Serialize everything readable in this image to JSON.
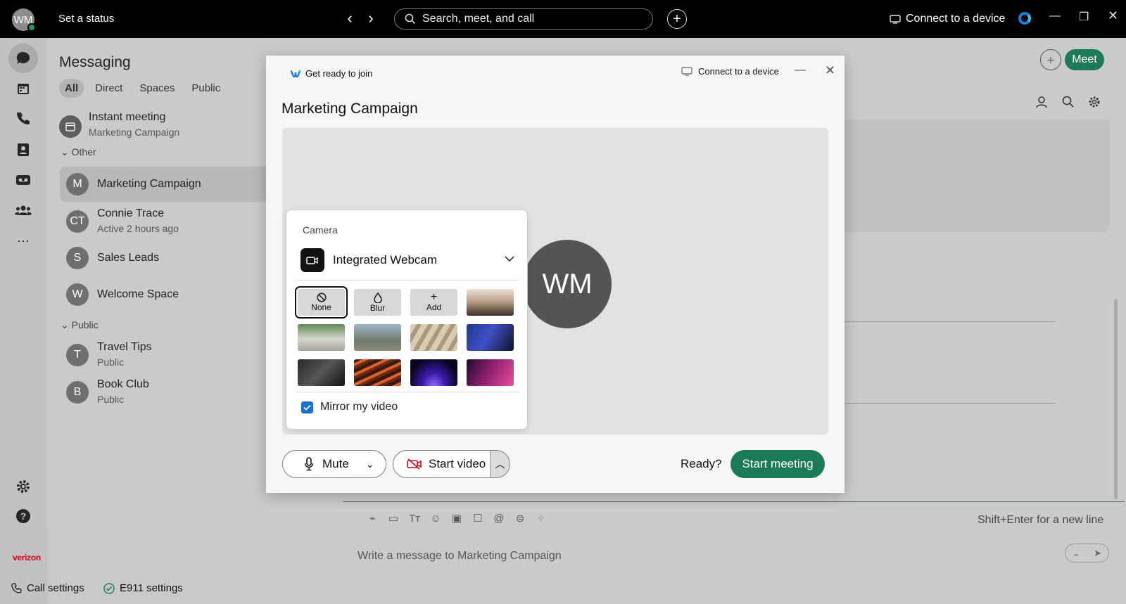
{
  "topbar": {
    "avatar_initials": "WM",
    "status_text": "Set a status",
    "search_placeholder": "Search, meet, and call",
    "connect_label": "Connect to a device"
  },
  "messaging": {
    "title": "Messaging",
    "filters": [
      "All",
      "Direct",
      "Spaces",
      "Public"
    ],
    "active_filter": "All",
    "instant_meeting": {
      "title": "Instant meeting",
      "subtitle": "Marketing Campaign"
    },
    "sections": {
      "other": "Other",
      "public": "Public"
    },
    "other_items": [
      {
        "initials": "M",
        "title": "Marketing Campaign",
        "subtitle": ""
      },
      {
        "initials": "CT",
        "title": "Connie Trace",
        "subtitle": "Active 2 hours ago"
      },
      {
        "initials": "S",
        "title": "Sales Leads",
        "subtitle": ""
      },
      {
        "initials": "W",
        "title": "Welcome Space",
        "subtitle": ""
      }
    ],
    "public_items": [
      {
        "initials": "T",
        "title": "Travel Tips",
        "subtitle": "Public"
      },
      {
        "initials": "B",
        "title": "Book Club",
        "subtitle": "Public"
      }
    ]
  },
  "space_header": {
    "meet_label": "Meet"
  },
  "composer": {
    "hint": "Shift+Enter for a new line",
    "placeholder": "Write a message to Marketing Campaign"
  },
  "brand": {
    "carrier": "verizon"
  },
  "bottombar": {
    "call_settings": "Call settings",
    "e911_settings": "E911 settings"
  },
  "dialog": {
    "title": "Get ready to join",
    "connect_label": "Connect to a device",
    "meeting_name": "Marketing Campaign",
    "avatar_initials": "WM",
    "camera": {
      "label": "Camera",
      "selected_camera": "Integrated Webcam",
      "options": {
        "none": "None",
        "blur": "Blur",
        "add": "Add"
      },
      "mirror_label": "Mirror my video",
      "mirror_checked": true
    },
    "mute_label": "Mute",
    "start_video_label": "Start video",
    "ready_label": "Ready?",
    "start_meeting_label": "Start meeting"
  },
  "colors": {
    "accent_green": "#1d7a57",
    "checkbox_blue": "#1c6fd1",
    "presence_green": "#1d9d5c",
    "carrier_red": "#d0021b"
  }
}
